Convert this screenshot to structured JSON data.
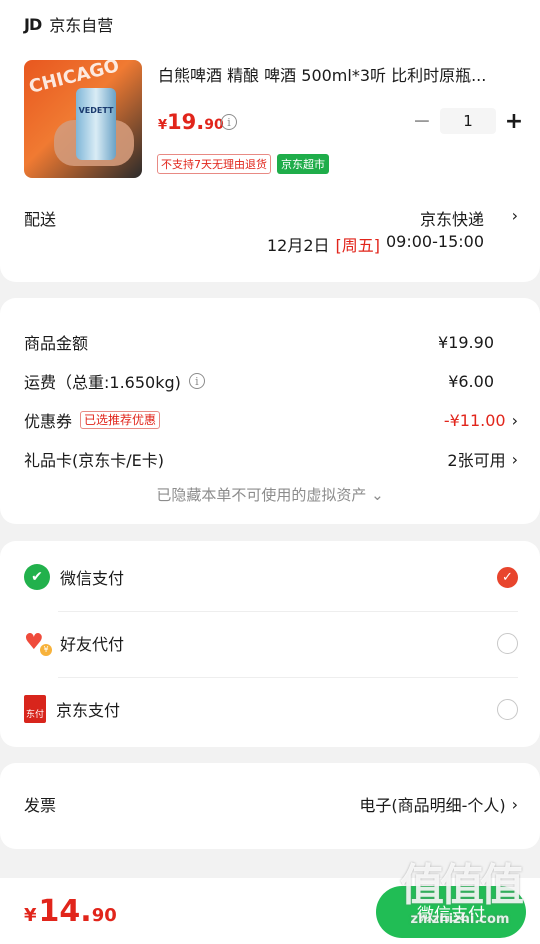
{
  "shop": {
    "logo": "JD",
    "name": "京东自营"
  },
  "product": {
    "image_shirt_text": "CHICAGO",
    "image_can_text": "VEDETT",
    "title": "白熊啤酒 精酿 啤酒 500ml*3听 比利时原瓶...",
    "price_yen": "¥",
    "price_int": "19.",
    "price_dec": "90",
    "quantity": "1",
    "minus": "−",
    "plus": "+",
    "tag_return": "不支持7天无理由退货",
    "tag_supermarket": "京东超市"
  },
  "delivery": {
    "label": "配送",
    "method": "京东快递",
    "date": "12月2日",
    "weekday": "[周五]",
    "time": "09:00-15:00"
  },
  "summary": {
    "goods_label": "商品金额",
    "goods_value": "¥19.90",
    "shipping_label": "运费（总重:1.650kg)",
    "shipping_value": "¥6.00",
    "coupon_label": "优惠券",
    "coupon_tag": "已选推荐优惠",
    "coupon_value": "-¥11.00",
    "giftcard_label": "礼品卡(京东卡/E卡)",
    "giftcard_value": "2张可用",
    "hidden_note": "已隐藏本单不可使用的虚拟资产 ⌄"
  },
  "payment": {
    "methods": [
      {
        "label": "微信支付",
        "icon": "wechat-pay-icon",
        "selected": true
      },
      {
        "label": "好友代付",
        "icon": "friend-pay-icon",
        "selected": false
      },
      {
        "label": "京东支付",
        "icon": "jd-pay-icon",
        "selected": false
      }
    ],
    "jd_icon_text": "东付"
  },
  "invoice": {
    "label": "发票",
    "value": "电子(商品明细-个人)"
  },
  "bottom": {
    "total_yen": "¥",
    "total_int": "14.",
    "total_dec": "90",
    "pay_button": "微信支付"
  },
  "watermark": {
    "main": "值值值",
    "sub": "zhizhizhi.com"
  },
  "colors": {
    "accent_red": "#e1251b",
    "wechat_green": "#21bd55",
    "background": "#f2f2f2"
  }
}
